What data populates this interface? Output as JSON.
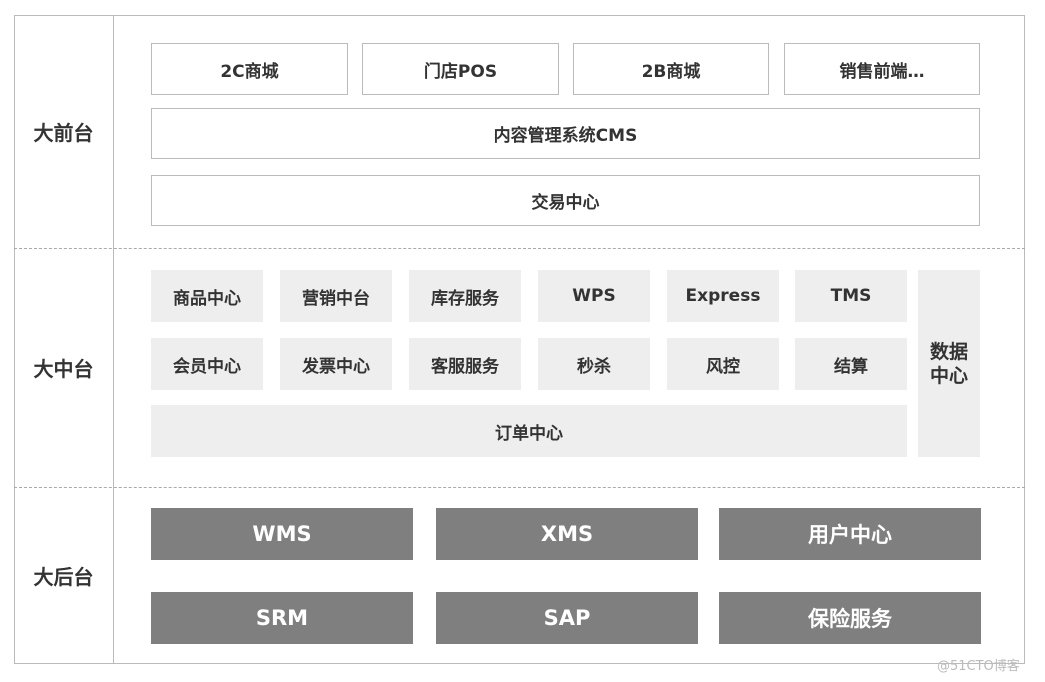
{
  "layers": {
    "front": "大前台",
    "middle": "大中台",
    "back": "大后台"
  },
  "front": {
    "channels": [
      "2C商城",
      "门店POS",
      "2B商城",
      "销售前端…"
    ],
    "cms": "内容管理系统CMS",
    "trade": "交易中心"
  },
  "middle": {
    "services": [
      "商品中心",
      "营销中台",
      "库存服务",
      "WPS",
      "Express",
      "TMS",
      "会员中心",
      "发票中心",
      "客服服务",
      "秒杀",
      "风控",
      "结算"
    ],
    "order": "订单中心",
    "data": "数据\n中心"
  },
  "back": {
    "systems": [
      "WMS",
      "XMS",
      "用户中心",
      "SRM",
      "SAP",
      "保险服务"
    ]
  },
  "watermark": "@51CTO博客",
  "colors": {
    "border": "#bbbbbb",
    "middle_fill": "#eeeeee",
    "back_fill": "#7f7f7f"
  }
}
